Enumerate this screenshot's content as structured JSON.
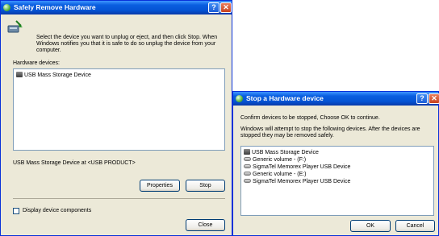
{
  "window1": {
    "title": "Safely Remove Hardware",
    "help": "?",
    "close": "✕",
    "instructions": [
      "Select the device you want to unplug or eject, and then click Stop. When",
      "Windows notifies you that it is safe to do so unplug the device from your",
      "computer."
    ],
    "hardware_label": "Hardware devices:",
    "devices": [
      "USB Mass Storage Device"
    ],
    "device_location": "USB Mass Storage Device at <USB PRODUCT>",
    "properties_button": "Properties",
    "stop_button": "Stop",
    "display_components": "Display device components",
    "close_button": "Close"
  },
  "window2": {
    "title": "Stop a Hardware device",
    "help": "?",
    "close": "✕",
    "confirm": "Confirm devices to be stopped, Choose OK to continue.",
    "warning": [
      "Windows will attempt to stop the following devices. After the devices are",
      "stopped they may be removed safely."
    ],
    "devices": [
      {
        "label": "USB Mass Storage Device",
        "icon": "usb-icon"
      },
      {
        "label": "Generic volume - (F:)",
        "icon": "drive-icon"
      },
      {
        "label": "SigmaTel Memorex Player USB Device",
        "icon": "drive-icon"
      },
      {
        "label": "Generic volume - (E:)",
        "icon": "drive-icon"
      },
      {
        "label": "SigmaTel Memorex Player USB Device",
        "icon": "drive-icon"
      }
    ],
    "ok_button": "OK",
    "cancel_button": "Cancel"
  }
}
